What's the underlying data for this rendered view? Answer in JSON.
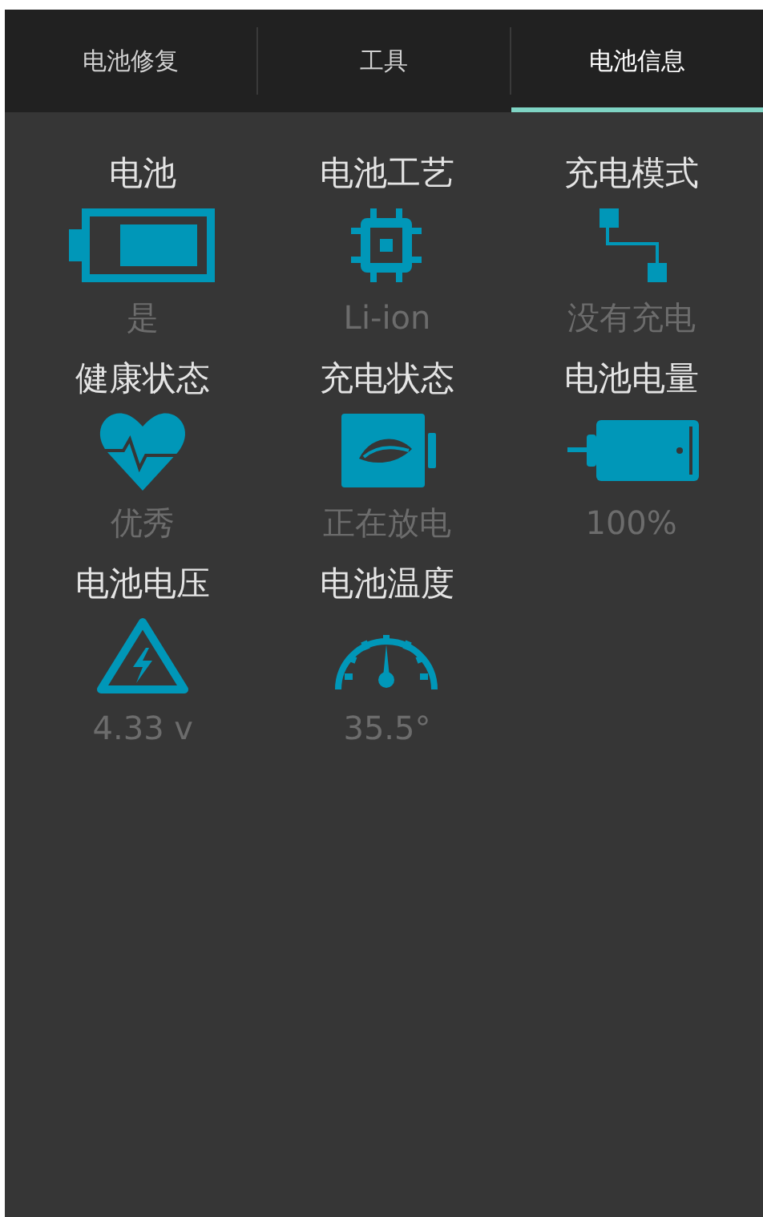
{
  "tabs": [
    {
      "label": "电池修复",
      "selected": false
    },
    {
      "label": "工具",
      "selected": false
    },
    {
      "label": "电池信息",
      "selected": true
    }
  ],
  "items": [
    {
      "kind": "battery",
      "title": "电池",
      "value": "是"
    },
    {
      "kind": "chip",
      "title": "电池工艺",
      "value": "Li-ion"
    },
    {
      "kind": "flow",
      "title": "充电模式",
      "value": "没有充电"
    },
    {
      "kind": "heart",
      "title": "健康状态",
      "value": "优秀"
    },
    {
      "kind": "leaf",
      "title": "充电状态",
      "value": "正在放电"
    },
    {
      "kind": "plug",
      "title": "电池电量",
      "value": "100%"
    },
    {
      "kind": "voltage",
      "title": "电池电压",
      "value": "4.33 v"
    },
    {
      "kind": "gauge",
      "title": "电池温度",
      "value": "35.5°"
    }
  ]
}
